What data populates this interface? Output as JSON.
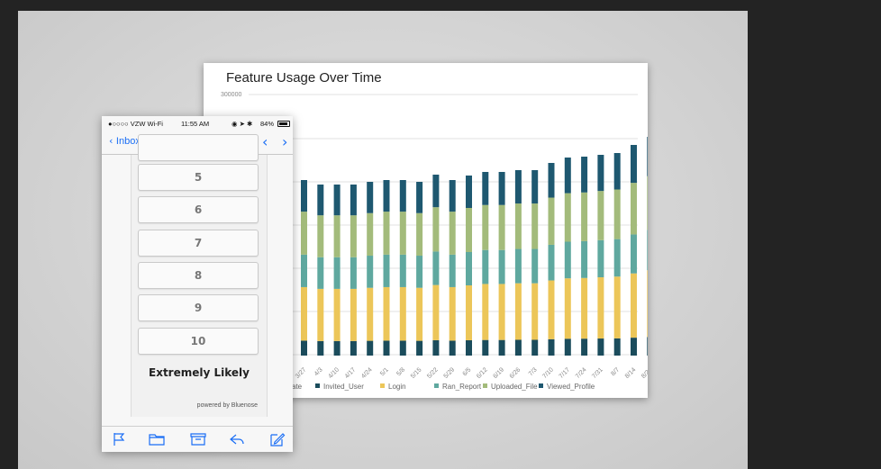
{
  "chart": {
    "title": "Feature Usage Over Time",
    "y_top_label": "300000"
  },
  "chart_data": {
    "type": "bar",
    "stacked": true,
    "title": "Feature Usage Over Time",
    "categories": [
      "3/27",
      "4/3",
      "4/10",
      "4/17",
      "4/24",
      "5/1",
      "5/8",
      "5/15",
      "5/22",
      "5/29",
      "6/5",
      "6/12",
      "6/19",
      "6/26",
      "7/3",
      "7/10",
      "7/17",
      "7/24",
      "7/31",
      "8/7",
      "8/14",
      "8/21"
    ],
    "series": [
      {
        "name": "Invited_User",
        "color": "#1b4c5c"
      },
      {
        "name": "Login",
        "color": "#ecc659"
      },
      {
        "name": "Ran_Report",
        "color": "#5fa89f"
      },
      {
        "name": "Uploaded_File",
        "color": "#a3bb7b"
      },
      {
        "name": "Viewed_Profile",
        "color": "#1e5870"
      }
    ],
    "legend_extra_label": "ate",
    "legend_position": "bottom",
    "grid": true
  },
  "phone": {
    "status": {
      "carrier": "●○○○○ VZW Wi-Fi",
      "time": "11:55 AM",
      "battery": "84%"
    },
    "nav": {
      "back_label": "Inbox (1097)"
    },
    "scale_options": [
      "5",
      "6",
      "7",
      "8",
      "9",
      "10"
    ],
    "bottom_label": "Extremely Likely",
    "powered_by": "powered by Bluenose"
  },
  "colors": {
    "accent": "#1a6ef5",
    "bar_invited_user": "#1b4c5c",
    "bar_login": "#ecc659",
    "bar_ran_report": "#5fa89f",
    "bar_uploaded_file": "#a3bb7b",
    "bar_viewed_profile": "#1e5870"
  },
  "icons": [
    "flag-icon",
    "folder-icon",
    "archive-icon",
    "reply-icon",
    "compose-icon"
  ]
}
